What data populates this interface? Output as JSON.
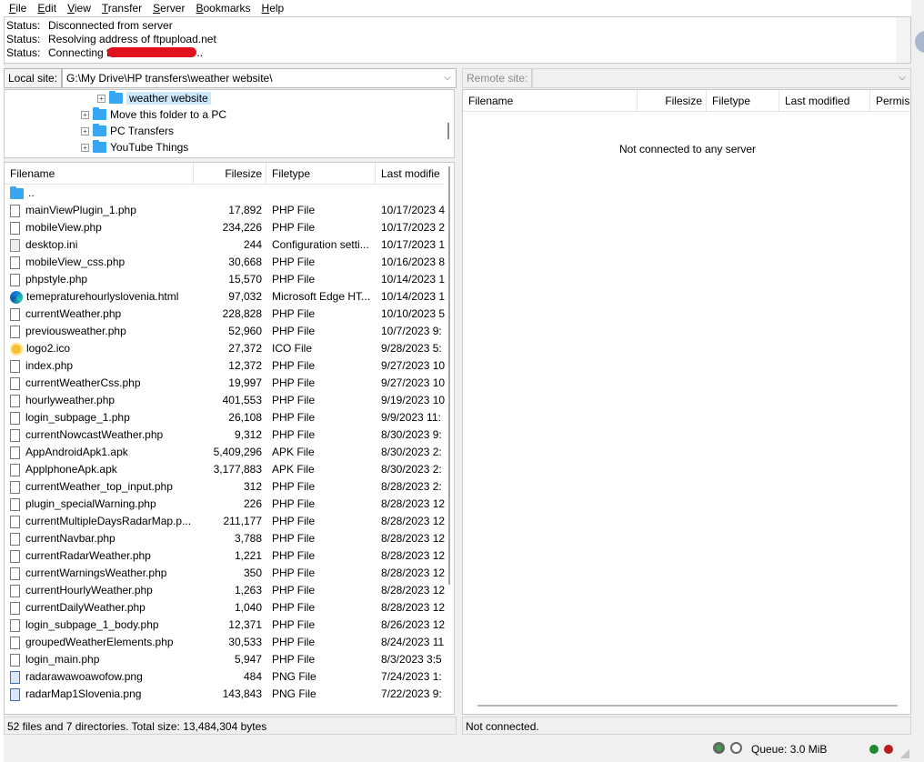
{
  "menu": [
    {
      "prefix": "",
      "accel": "F",
      "rest": "ile"
    },
    {
      "prefix": "",
      "accel": "E",
      "rest": "dit"
    },
    {
      "prefix": "",
      "accel": "V",
      "rest": "iew"
    },
    {
      "prefix": "",
      "accel": "T",
      "rest": "ransfer"
    },
    {
      "prefix": "",
      "accel": "S",
      "rest": "erver"
    },
    {
      "prefix": "",
      "accel": "B",
      "rest": "ookmarks"
    },
    {
      "prefix": "",
      "accel": "H",
      "rest": "elp"
    }
  ],
  "status_log": [
    {
      "label": "Status:",
      "message": "Disconnected from server"
    },
    {
      "label": "Status:",
      "message": "Resolving address of ftpupload.net"
    },
    {
      "label": "Status:",
      "message_before": "Connecting t",
      "message_after": ".."
    }
  ],
  "local": {
    "site_label": "Local site:",
    "site_path": "G:\\My Drive\\HP transfers\\weather website\\",
    "tree": [
      {
        "label": "weather website",
        "selected": true
      },
      {
        "label": "Move this folder to a PC",
        "selected": false
      },
      {
        "label": "PC Transfers",
        "selected": false
      },
      {
        "label": "YouTube Things",
        "selected": false
      }
    ],
    "columns": {
      "name": "Filename",
      "size": "Filesize",
      "type": "Filetype",
      "modified": "Last modifie"
    },
    "files": [
      {
        "icon": "folder",
        "name": "..",
        "size": "",
        "type": "",
        "modified": ""
      },
      {
        "icon": "file",
        "name": "mainViewPlugin_1.php",
        "size": "17,892",
        "type": "PHP File",
        "modified": "10/17/2023 4"
      },
      {
        "icon": "file",
        "name": "mobileView.php",
        "size": "234,226",
        "type": "PHP File",
        "modified": "10/17/2023 2"
      },
      {
        "icon": "cfg",
        "name": "desktop.ini",
        "size": "244",
        "type": "Configuration setti...",
        "modified": "10/17/2023 1"
      },
      {
        "icon": "file",
        "name": "mobileView_css.php",
        "size": "30,668",
        "type": "PHP File",
        "modified": "10/16/2023 8"
      },
      {
        "icon": "file",
        "name": "phpstyle.php",
        "size": "15,570",
        "type": "PHP File",
        "modified": "10/14/2023 1"
      },
      {
        "icon": "edge",
        "name": "temepraturehourlyslovenia.html",
        "size": "97,032",
        "type": "Microsoft Edge HT...",
        "modified": "10/14/2023 1"
      },
      {
        "icon": "file",
        "name": "currentWeather.php",
        "size": "228,828",
        "type": "PHP File",
        "modified": "10/10/2023 5"
      },
      {
        "icon": "file",
        "name": "previousweather.php",
        "size": "52,960",
        "type": "PHP File",
        "modified": "10/7/2023 9:"
      },
      {
        "icon": "ico",
        "name": "logo2.ico",
        "size": "27,372",
        "type": "ICO File",
        "modified": "9/28/2023 5:"
      },
      {
        "icon": "file",
        "name": "index.php",
        "size": "12,372",
        "type": "PHP File",
        "modified": "9/27/2023 10"
      },
      {
        "icon": "file",
        "name": "currentWeatherCss.php",
        "size": "19,997",
        "type": "PHP File",
        "modified": "9/27/2023 10"
      },
      {
        "icon": "file",
        "name": "hourlyweather.php",
        "size": "401,553",
        "type": "PHP File",
        "modified": "9/19/2023 10"
      },
      {
        "icon": "file",
        "name": "login_subpage_1.php",
        "size": "26,108",
        "type": "PHP File",
        "modified": "9/9/2023 11:"
      },
      {
        "icon": "file",
        "name": "currentNowcastWeather.php",
        "size": "9,312",
        "type": "PHP File",
        "modified": "8/30/2023 9:"
      },
      {
        "icon": "file",
        "name": "AppAndroidApk1.apk",
        "size": "5,409,296",
        "type": "APK File",
        "modified": "8/30/2023 2:"
      },
      {
        "icon": "file",
        "name": "ApplphoneApk.apk",
        "size": "3,177,883",
        "type": "APK File",
        "modified": "8/30/2023 2:"
      },
      {
        "icon": "file",
        "name": "currentWeather_top_input.php",
        "size": "312",
        "type": "PHP File",
        "modified": "8/28/2023 2:"
      },
      {
        "icon": "file",
        "name": "plugin_specialWarning.php",
        "size": "226",
        "type": "PHP File",
        "modified": "8/28/2023 12"
      },
      {
        "icon": "file",
        "name": "currentMultipleDaysRadarMap.p...",
        "size": "211,177",
        "type": "PHP File",
        "modified": "8/28/2023 12"
      },
      {
        "icon": "file",
        "name": "currentNavbar.php",
        "size": "3,788",
        "type": "PHP File",
        "modified": "8/28/2023 12"
      },
      {
        "icon": "file",
        "name": "currentRadarWeather.php",
        "size": "1,221",
        "type": "PHP File",
        "modified": "8/28/2023 12"
      },
      {
        "icon": "file",
        "name": "currentWarningsWeather.php",
        "size": "350",
        "type": "PHP File",
        "modified": "8/28/2023 12"
      },
      {
        "icon": "file",
        "name": "currentHourlyWeather.php",
        "size": "1,263",
        "type": "PHP File",
        "modified": "8/28/2023 12"
      },
      {
        "icon": "file",
        "name": "currentDailyWeather.php",
        "size": "1,040",
        "type": "PHP File",
        "modified": "8/28/2023 12"
      },
      {
        "icon": "file",
        "name": "login_subpage_1_body.php",
        "size": "12,371",
        "type": "PHP File",
        "modified": "8/26/2023 12"
      },
      {
        "icon": "file",
        "name": "groupedWeatherElements.php",
        "size": "30,533",
        "type": "PHP File",
        "modified": "8/24/2023 11"
      },
      {
        "icon": "file",
        "name": "login_main.php",
        "size": "5,947",
        "type": "PHP File",
        "modified": "8/3/2023 3:5"
      },
      {
        "icon": "img",
        "name": "radarawawoawofow.png",
        "size": "484",
        "type": "PNG File",
        "modified": "7/24/2023 1:"
      },
      {
        "icon": "img",
        "name": "radarMap1Slovenia.png",
        "size": "143,843",
        "type": "PNG File",
        "modified": "7/22/2023 9:"
      }
    ],
    "summary": "52 files and 7 directories. Total size: 13,484,304 bytes"
  },
  "remote": {
    "site_label": "Remote site:",
    "site_path": "",
    "columns": {
      "name": "Filename",
      "size": "Filesize",
      "type": "Filetype",
      "modified": "Last modified",
      "perms": "Permiss"
    },
    "empty_message": "Not connected to any server",
    "summary": "Not connected."
  },
  "statusbar": {
    "queue": "Queue: 3.0 MiB"
  }
}
